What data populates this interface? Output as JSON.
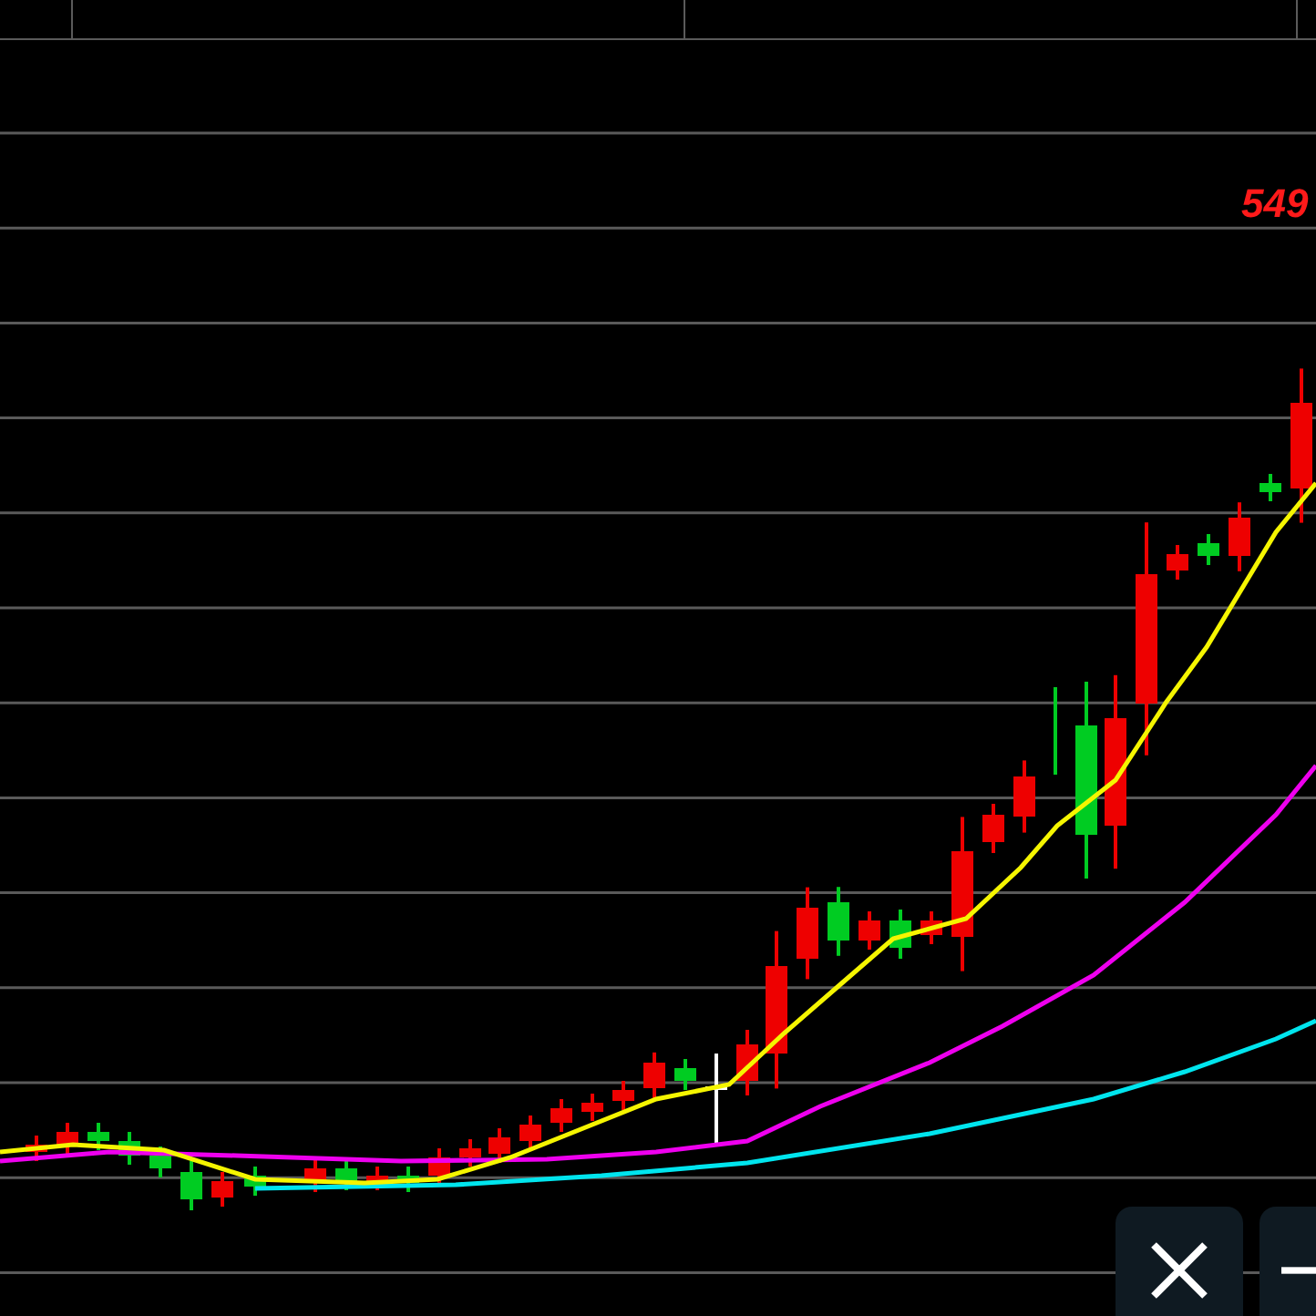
{
  "chart": {
    "price_label": "549"
  },
  "buttons": [
    {
      "kind": "close"
    },
    {
      "kind": "minus"
    }
  ]
}
